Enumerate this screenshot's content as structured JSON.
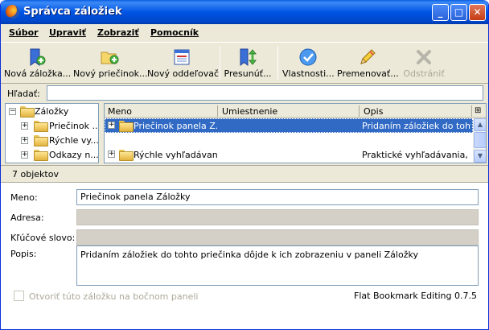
{
  "window": {
    "title": "Správca záložiek"
  },
  "menu": {
    "items": [
      "Súbor",
      "Upraviť",
      "Zobraziť",
      "Pomocník"
    ]
  },
  "toolbar": {
    "new_bookmark": "Nová záložka...",
    "new_folder": "Nový priečinok...",
    "new_separator": "Nový oddeľovač",
    "move": "Presunúť...",
    "properties": "Vlastnosti...",
    "rename": "Premenovať...",
    "delete": "Odstrániť"
  },
  "search": {
    "label": "Hľadať:",
    "value": ""
  },
  "tree": {
    "root": "Záložky",
    "children": [
      "Priečinok ...",
      "Rýchle vy...",
      "Odkazy n..."
    ]
  },
  "list": {
    "columns": [
      "Meno",
      "Umiestnenie",
      "Opis"
    ],
    "rows": [
      {
        "name": "Priečinok panela Z...",
        "location": "",
        "description": "Pridaním záložiek do tohto ...",
        "selected": true
      },
      {
        "name": "",
        "location": "",
        "description": "",
        "selected": false
      },
      {
        "name": "Rýchle vyhľadávanie",
        "location": "",
        "description": "Praktické vyhľadávania, ...",
        "selected": false
      }
    ]
  },
  "status": {
    "text": "7 objektov"
  },
  "details": {
    "name_label": "Meno:",
    "name_value": "Priečinok panela Záložky",
    "address_label": "Adresa:",
    "address_value": "",
    "keyword_label": "Kľúčové slovo:",
    "keyword_value": "",
    "description_label": "Popis:",
    "description_value": "Pridaním záložiek do tohto priečinka dôjde k ich zobrazeniu v paneli Záložky",
    "sidebar_checkbox_label": "Otvoriť túto záložku na bočnom paneli",
    "version": "Flat Bookmark Editing 0.7.5"
  },
  "colors": {
    "titlebar": "#0055e5",
    "selection": "#316ac5",
    "chrome": "#ece9d8"
  }
}
